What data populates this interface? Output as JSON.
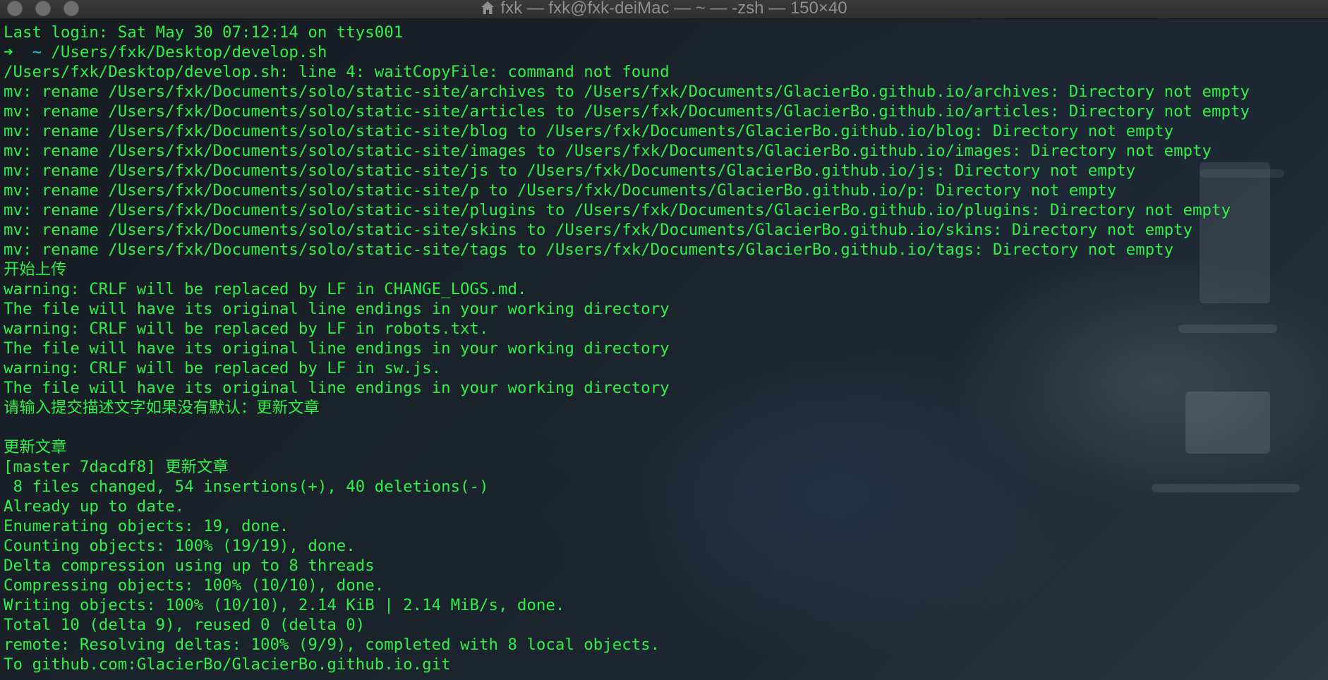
{
  "window": {
    "title": "fxk — fxk@fxk-deiMac — ~ — -zsh — 150×40",
    "controls": [
      "close",
      "minimize",
      "zoom"
    ]
  },
  "terminal": {
    "text_color": "#2ef047",
    "prompt_tilde_color": "#2ecbd8",
    "prompt": {
      "arrow": "➜",
      "dir": "~",
      "command": "/Users/fxk/Desktop/develop.sh"
    },
    "lines": [
      "Last login: Sat May 30 07:12:14 on ttys001",
      "__PROMPT__",
      "/Users/fxk/Desktop/develop.sh: line 4: waitCopyFile: command not found",
      "mv: rename /Users/fxk/Documents/solo/static-site/archives to /Users/fxk/Documents/GlacierBo.github.io/archives: Directory not empty",
      "mv: rename /Users/fxk/Documents/solo/static-site/articles to /Users/fxk/Documents/GlacierBo.github.io/articles: Directory not empty",
      "mv: rename /Users/fxk/Documents/solo/static-site/blog to /Users/fxk/Documents/GlacierBo.github.io/blog: Directory not empty",
      "mv: rename /Users/fxk/Documents/solo/static-site/images to /Users/fxk/Documents/GlacierBo.github.io/images: Directory not empty",
      "mv: rename /Users/fxk/Documents/solo/static-site/js to /Users/fxk/Documents/GlacierBo.github.io/js: Directory not empty",
      "mv: rename /Users/fxk/Documents/solo/static-site/p to /Users/fxk/Documents/GlacierBo.github.io/p: Directory not empty",
      "mv: rename /Users/fxk/Documents/solo/static-site/plugins to /Users/fxk/Documents/GlacierBo.github.io/plugins: Directory not empty",
      "mv: rename /Users/fxk/Documents/solo/static-site/skins to /Users/fxk/Documents/GlacierBo.github.io/skins: Directory not empty",
      "mv: rename /Users/fxk/Documents/solo/static-site/tags to /Users/fxk/Documents/GlacierBo.github.io/tags: Directory not empty",
      "开始上传",
      "warning: CRLF will be replaced by LF in CHANGE_LOGS.md.",
      "The file will have its original line endings in your working directory",
      "warning: CRLF will be replaced by LF in robots.txt.",
      "The file will have its original line endings in your working directory",
      "warning: CRLF will be replaced by LF in sw.js.",
      "The file will have its original line endings in your working directory",
      "请输入提交描述文字如果没有默认：更新文章",
      "",
      "更新文章",
      "[master 7dacdf8] 更新文章",
      " 8 files changed, 54 insertions(+), 40 deletions(-)",
      "Already up to date.",
      "Enumerating objects: 19, done.",
      "Counting objects: 100% (19/19), done.",
      "Delta compression using up to 8 threads",
      "Compressing objects: 100% (10/10), done.",
      "Writing objects: 100% (10/10), 2.14 KiB | 2.14 MiB/s, done.",
      "Total 10 (delta 9), reused 0 (delta 0)",
      "remote: Resolving deltas: 100% (9/9), completed with 8 local objects.",
      "To github.com:GlacierBo/GlacierBo.github.io.git"
    ]
  }
}
